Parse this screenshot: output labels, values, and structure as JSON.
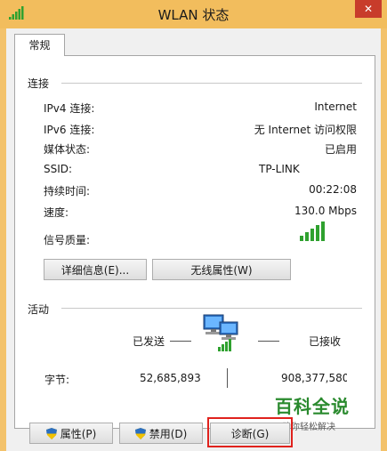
{
  "window": {
    "title": "WLAN 状态",
    "close_glyph": "✕"
  },
  "tabs": [
    {
      "label": "常规",
      "active": true
    }
  ],
  "connection": {
    "header": "连接",
    "rows": [
      {
        "label": "IPv4 连接:",
        "value": "Internet"
      },
      {
        "label": "IPv6 连接:",
        "value": "无 Internet 访问权限"
      },
      {
        "label": "媒体状态:",
        "value": "已启用"
      },
      {
        "label": "SSID:",
        "value": "TP-LINK"
      },
      {
        "label": "持续时间:",
        "value": "00:22:08"
      },
      {
        "label": "速度:",
        "value": "130.0 Mbps"
      },
      {
        "label": "信号质量:",
        "value": ""
      }
    ],
    "signal_level": "5 of 5 bars",
    "details_button": "详细信息(E)...",
    "wireless_props_button": "无线属性(W)"
  },
  "activity": {
    "header": "活动",
    "sent_label": "已发送",
    "received_label": "已接收",
    "bytes_label": "字节:",
    "bytes_sent": "52,685,893",
    "bytes_received": "908,377,580"
  },
  "bottom_buttons": {
    "properties": "属性(P)",
    "disable": "禁用(D)",
    "diagnose": "诊断(G)"
  },
  "watermark": {
    "title": "百科全说",
    "subtitle": "助你轻松解决"
  },
  "colors": {
    "title_bar": "#f2bd5d",
    "close_button": "#c83c2b",
    "signal_green": "#2fa12f",
    "highlight_red": "#e0221d"
  }
}
